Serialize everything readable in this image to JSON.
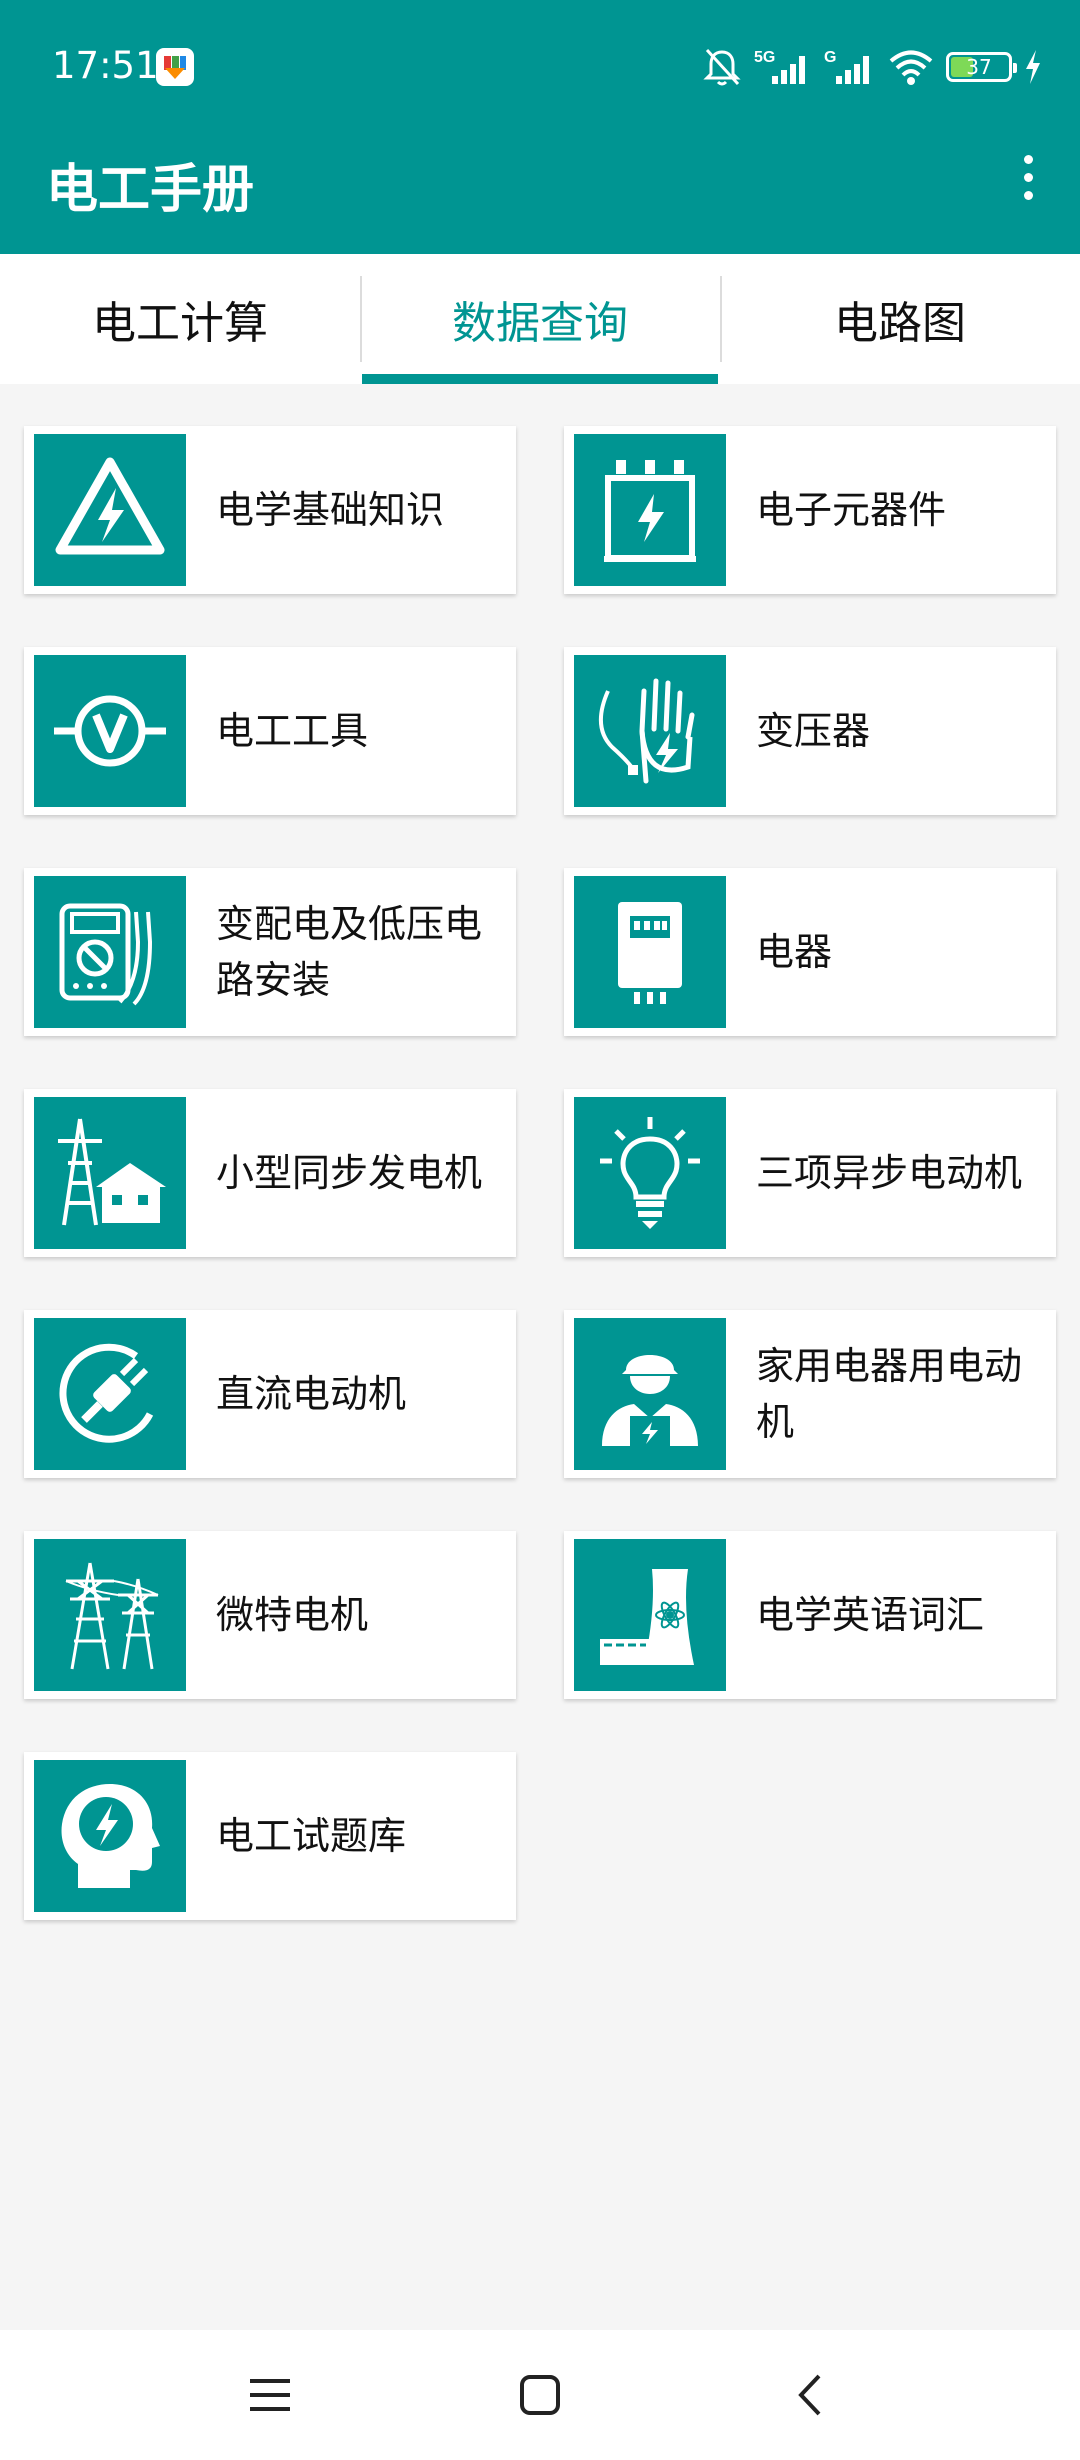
{
  "status_bar": {
    "time": "17:51",
    "network_1": "5G",
    "network_2": "G",
    "battery_level": "37",
    "icons": [
      "mute-bell-icon",
      "signal-5g-icon",
      "signal-g-icon",
      "wifi-icon",
      "battery-icon",
      "charging-bolt-icon"
    ]
  },
  "app_bar": {
    "title": "电工手册",
    "menu_icon": "more-vert-icon"
  },
  "tabs": [
    {
      "label": "电工计算",
      "active": false
    },
    {
      "label": "数据查询",
      "active": true
    },
    {
      "label": "电路图",
      "active": false
    }
  ],
  "categories": [
    {
      "label": "电学基础知识",
      "icon": "high-voltage-triangle-icon"
    },
    {
      "label": "电子元器件",
      "icon": "transformer-box-icon"
    },
    {
      "label": "电工工具",
      "icon": "voltmeter-icon"
    },
    {
      "label": "变压器",
      "icon": "hand-shock-icon"
    },
    {
      "label": "变配电及低压电路安装",
      "icon": "multimeter-icon"
    },
    {
      "label": "电器",
      "icon": "electric-meter-icon"
    },
    {
      "label": "小型同步发电机",
      "icon": "pylon-house-icon"
    },
    {
      "label": "三项异步电动机",
      "icon": "light-bulb-icon"
    },
    {
      "label": "直流电动机",
      "icon": "plug-icon"
    },
    {
      "label": "家用电器用电动机",
      "icon": "electrician-icon"
    },
    {
      "label": "微特电机",
      "icon": "power-towers-icon"
    },
    {
      "label": "电学英语词汇",
      "icon": "nuclear-plant-icon"
    },
    {
      "label": "电工试题库",
      "icon": "head-bolt-icon"
    }
  ],
  "nav_bar": {
    "icons": [
      "menu-icon",
      "home-icon",
      "back-icon"
    ]
  },
  "colors": {
    "primary": "#009592",
    "background": "#f5f5f5",
    "card": "#ffffff"
  }
}
